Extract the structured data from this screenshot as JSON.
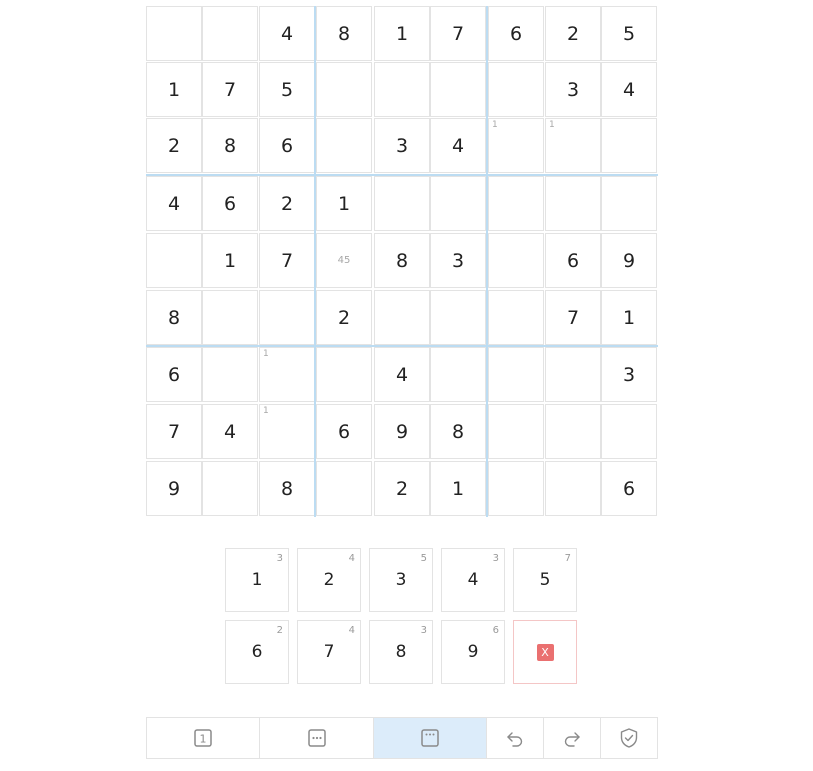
{
  "board": {
    "givens": [
      [
        "",
        "",
        "4",
        "8",
        "1",
        "7",
        "6",
        "2",
        "5"
      ],
      [
        "1",
        "7",
        "5",
        "",
        "",
        "",
        "",
        "3",
        "4"
      ],
      [
        "2",
        "8",
        "6",
        "",
        "3",
        "4",
        "",
        "",
        ""
      ],
      [
        "4",
        "6",
        "2",
        "1",
        "",
        "",
        "",
        "",
        ""
      ],
      [
        "",
        "1",
        "7",
        "",
        "8",
        "3",
        "",
        "6",
        "9"
      ],
      [
        "8",
        "",
        "",
        "2",
        "",
        "",
        "",
        "7",
        "1"
      ],
      [
        "6",
        "",
        "",
        "",
        "4",
        "",
        "",
        "",
        "3"
      ],
      [
        "7",
        "4",
        "",
        "6",
        "9",
        "8",
        "",
        "",
        ""
      ],
      [
        "9",
        "",
        "8",
        "",
        "2",
        "1",
        "",
        "",
        "6"
      ]
    ],
    "notes": [
      {
        "row": 2,
        "col": 6,
        "text": "1",
        "pos": "corner"
      },
      {
        "row": 2,
        "col": 7,
        "text": "1",
        "pos": "corner"
      },
      {
        "row": 4,
        "col": 3,
        "text": "45",
        "pos": "center"
      },
      {
        "row": 6,
        "col": 2,
        "text": "1",
        "pos": "corner"
      },
      {
        "row": 7,
        "col": 2,
        "text": "1",
        "pos": "corner"
      }
    ]
  },
  "numpad": {
    "keys": [
      {
        "digit": "1",
        "remaining": "3"
      },
      {
        "digit": "2",
        "remaining": "4"
      },
      {
        "digit": "3",
        "remaining": "5"
      },
      {
        "digit": "4",
        "remaining": "3"
      },
      {
        "digit": "5",
        "remaining": "7"
      },
      {
        "digit": "6",
        "remaining": "2"
      },
      {
        "digit": "7",
        "remaining": "4"
      },
      {
        "digit": "8",
        "remaining": "3"
      },
      {
        "digit": "9",
        "remaining": "6"
      }
    ],
    "erase_label": "X"
  },
  "toolbar": {
    "tools": [
      {
        "name": "normal-mode",
        "icon": "box-digit-icon",
        "glyph": "1",
        "active": false
      },
      {
        "name": "corner-mode",
        "icon": "box-dots-icon",
        "glyph": "",
        "active": false
      },
      {
        "name": "center-mode",
        "icon": "box-center-icon",
        "glyph": "",
        "active": true
      },
      {
        "name": "undo",
        "icon": "undo-icon",
        "glyph": "",
        "active": false
      },
      {
        "name": "redo",
        "icon": "redo-icon",
        "glyph": "",
        "active": false
      },
      {
        "name": "check",
        "icon": "shield-check-icon",
        "glyph": "",
        "active": false
      }
    ]
  },
  "colors": {
    "accent": "#bcdcf2",
    "active_tool": "#dcecfa",
    "erase": "#ea7070",
    "icon": "#8a8a8a"
  }
}
